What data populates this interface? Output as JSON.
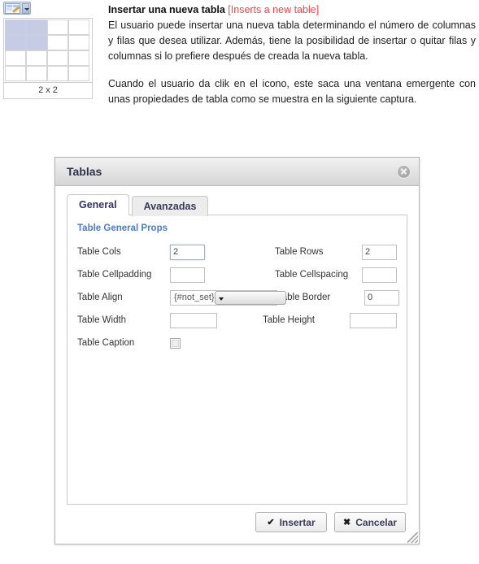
{
  "toolbar": {
    "icon_name": "insert-table-icon",
    "dropdown_name": "dropdown-arrow-icon"
  },
  "picker": {
    "cols": 4,
    "rows": 4,
    "selected_cols": 2,
    "selected_rows": 2,
    "label": "2 x 2",
    "highlight_color": "#c5cce3"
  },
  "doc": {
    "heading_es": "Insertar una nueva tabla",
    "heading_en": "[Inserts a new table]",
    "paragraph1": "El usuario puede insertar una nueva tabla determinando el número de columnas y filas que desea utilizar. Además, tiene la posibilidad de insertar o quitar filas y columnas si lo prefiere después de creada la nueva tabla.",
    "paragraph2": "Cuando el usuario da clik en el icono, este saca una ventana emergente con unas propiedades de tabla como se muestra en la siguiente captura.",
    "heading_en_color": "#f0464a"
  },
  "dialog": {
    "title": "Tablas",
    "close_label": "",
    "tabs": [
      {
        "label": "General",
        "active": true
      },
      {
        "label": "Avanzadas",
        "active": false
      }
    ],
    "panel_heading": "Table General Props",
    "panel_heading_color": "#4f7cbf",
    "fields": {
      "cols_label": "Table Cols",
      "cols_value": "2",
      "rows_label": "Table Rows",
      "rows_value": "2",
      "cellpadding_label": "Table Cellpadding",
      "cellpadding_value": "",
      "cellspacing_label": "Table Cellspacing",
      "cellspacing_value": "",
      "align_label": "Table Align",
      "align_value": "{#not_set}",
      "border_label": "Table Border",
      "border_value": "0",
      "width_label": "Table Width",
      "width_value": "",
      "height_label": "Table Height",
      "height_value": "",
      "caption_label": "Table Caption",
      "caption_checked": false
    },
    "buttons": {
      "insert_mark": "✔",
      "insert_label": "Insertar",
      "cancel_mark": "✖",
      "cancel_label": "Cancelar"
    }
  }
}
